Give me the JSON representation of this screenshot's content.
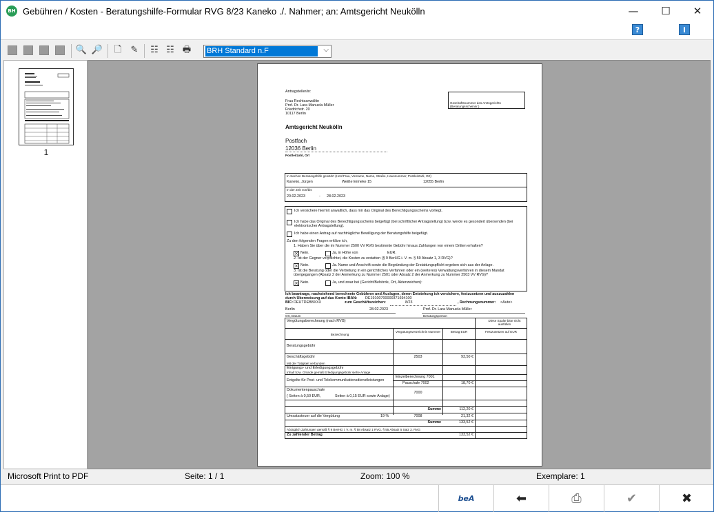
{
  "window": {
    "icon_text": "BH",
    "title": "Gebühren / Kosten - Beratungshilfe-Formular RVG 8/23 Kaneko ./. Nahmer; an: Amtsgericht Neukölln",
    "minimize": "—",
    "maximize": "☐",
    "close": "✕"
  },
  "helpbar": {
    "help_icon": "?",
    "info_icon": "i"
  },
  "toolbar": {
    "template_select": {
      "value": "BRH Standard n.F"
    }
  },
  "thumbnails": {
    "page_number": "1"
  },
  "document": {
    "sender_label": "Antragsteller/in:",
    "sender_lines": [
      "Frau Rechtsanwältin",
      "Prof. Dr. Lara Manuela Müller",
      "Friedrichstr. 20",
      "10117 Berlin"
    ],
    "case_box": "Geschäftsnummer des Amtsgerichts (Beratungsscheinnr.)",
    "court": "Amtsgericht Neukölln",
    "postfach": "Postfach",
    "postal_city": "12036 Berlin",
    "postleitzahl_label": "Postleitzahl, Ort",
    "client_header": "In Sachen Beratungshilfe gewährt (Herr/Frau, Vorname, Name, Straße, Hausnummer, Postleitzahl, Ort)",
    "client_name": "Kaneko, Jürgen",
    "client_street": "Weiße Ermeke 15",
    "client_city": "12055 Berlin",
    "period_label": "In der Zeit von/bis",
    "period_from": "20.02.2023",
    "period_dash": "-",
    "period_to": "28.02.2023",
    "check1": "Ich versichere hiermit anwaltlich, dass mir das Original des Berechtigungsscheins vorliegt.",
    "check2": "Ich habe das Original des Berechtigungsscheins beigefügt (bei schriftlicher Antragstellung) bzw. werde es gesondert übersenden (bei elektronischer Antragstellung).",
    "check3": "Ich habe einen Antrag auf nachträgliche Bewilligung der Beratungshilfe beigefügt.",
    "questions_intro": "Zu den folgenden Fragen erkläre ich,",
    "q1": "1. Haben Sie über die im Nummer 2500 VV RVG bestimmte Gebühr hinaus Zahlungen von einem Dritten erhalten?",
    "q1_no": "Nein.",
    "q1_yes": "Ja, in Höhe von",
    "q1_eur": "EUR.",
    "q2": "2. Ist der Gegner verpflichtet, die Kosten zu erstatten (§ 9 BerHG i. V. m. § 59 Absatz 1, 3 RVG)?",
    "q2_no": "Nein.",
    "q2_yes": "Ja. Name und Anschrift sowie die Begründung der Erstattungspflicht ergeben sich aus der Anlage.",
    "q3": "3. Ist die Beratung oder die Vertretung in ein gerichtliches Verfahren oder ein (weiteres) Verwaltungsverfahren in diesem Mandat übergegangen (Absatz 2 der Anmerkung zu Nummer 2501 oder Absatz 2 der Anmerkung zu Nummer 2503 VV RVG)?",
    "q3_no": "Nein.",
    "q3_yes": "Ja, und zwar bei (Gericht/Behörde, Ort, Aktenzeichen):",
    "request_text": "Ich beantrage, nachstehend berechnete Gebühren und Auslagen, deren Entstehung ich versichere, festzusetzen und auszuzahlen",
    "transfer_label": "durch Überweisung auf das Konto IBAN:",
    "iban": "DE19100700000371694100",
    "bic_label": "BIC:",
    "bic": "DEUTDEBBXXX",
    "ref_label": "zum Geschäftszeichen:",
    "ref_value": "8/23",
    "invoice_label": ", Rechnungsnummer:",
    "invoice_value": "<Auto>",
    "place": "Berlin",
    "date": "28.02.2023",
    "signer": "Prof. Dr. Lara Manuela Müller",
    "place_label": "Ort, Datum",
    "signer_label": "Beratungsperson",
    "fees_title": "Vergütungsberechnung (nach RVG)",
    "fees_side": "Diese Spalte bitte nicht ausfüllen",
    "col_desc": "Bezeichnung",
    "col_nr": "Vergütungsverzeichnis Nummer",
    "col_amount": "Betrag EUR",
    "col_fixed": "Festzusetzen auf EUR",
    "row_beratung": "Beratungsgebühr",
    "row_geschaeft": "Geschäftsgebühr",
    "row_geschaeft_nr": "2503",
    "row_geschaeft_amt": "93,50 €",
    "row_geschaeft_sub": "Mit der Tätigkeit verbunden",
    "row_einigung": "Einigungs- und Erledigungsgebühr",
    "row_einigung_sub": "Inhalt bzw. Gründe gemäß Erledigungsgebühr siehe Anlage",
    "row_entgelt": "Entgelte für Post- und Telekommunikationsdienstleistungen",
    "row_entgelt_a": "Einzelberechnung 7001",
    "row_entgelt_b": "Pauschale 7002",
    "row_entgelt_amt": "18,70 €",
    "row_dok": "Dokumentenpauschale",
    "row_dok_nr": "7000",
    "row_dok_sub1": "(     Seiten à 0,50 EUR,",
    "row_dok_sub2": "Seiten à 0,15 EUR sowie Anlage)",
    "sum_label": "Summe",
    "sum_value": "112,20 €",
    "vat_label": "Umsatzsteuer auf die Vergütung",
    "vat_rate": "19 %",
    "vat_nr": "7008",
    "vat_value": "21,32 €",
    "sum2_label": "Summe",
    "sum2_value": "133,52 €",
    "deduct_label": "Abzüglich Zahlungen gemäß § 9 BerHG i. V. m. § 58 Absatz 1 RVG, § 55 Absatz 5 Satz 3. RVG",
    "total_label": "Zu zahlender Betrag",
    "total_value": "133,52 €"
  },
  "statusbar": {
    "printer": "Microsoft Print to PDF",
    "page": "Seite: 1 / 1",
    "zoom": "Zoom: 100 %",
    "copies": "Exemplare: 1"
  },
  "bottombar": {
    "bea_label": "beA",
    "back_glyph": "⬅",
    "print_glyph": "⎙",
    "ok_glyph": "✔",
    "cancel_glyph": "✖"
  }
}
